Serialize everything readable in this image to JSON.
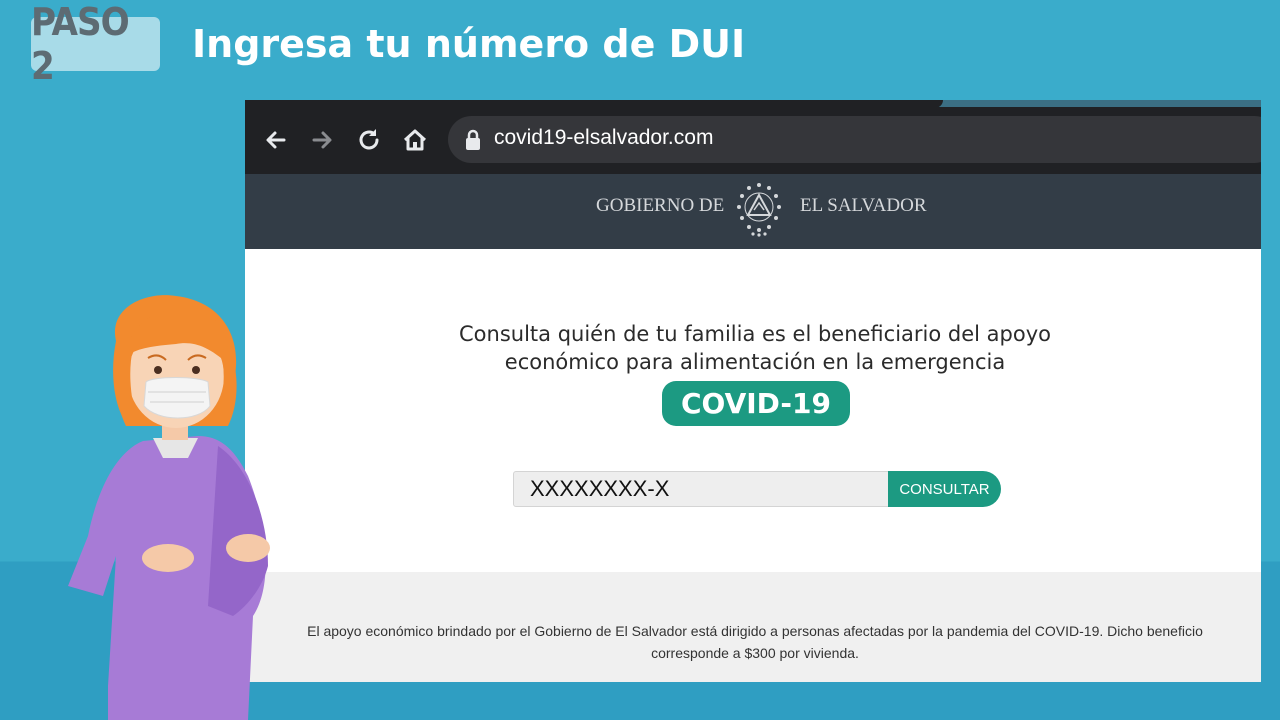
{
  "step": {
    "badge": "PASO 2",
    "title": "Ingresa tu número de DUI"
  },
  "browser": {
    "url": "covid19-elsalvador.com",
    "icons": [
      "arrow-left-icon",
      "arrow-right-icon",
      "reload-icon",
      "home-icon",
      "lock-icon"
    ]
  },
  "site": {
    "header": {
      "left": "GOBIERNO DE",
      "right": "EL SALVADOR"
    },
    "lead_line1": "Consulta quién de tu familia es el beneficiario del apoyo",
    "lead_line2": "económico para alimentación en la emergencia",
    "badge": "COVID-19",
    "input_value": "XXXXXXXX-X",
    "button": "CONSULTAR",
    "footer_line1": "El apoyo económico brindado por el Gobierno de El Salvador está dirigido a personas afectadas por la pandemia del COVID-19. Dicho beneficio",
    "footer_line2": "corresponde a $300 por vivienda."
  },
  "colors": {
    "background": "#3aaccb",
    "accent": "#1c9a82",
    "header": "#333d47",
    "browser_chrome": "#202124"
  }
}
